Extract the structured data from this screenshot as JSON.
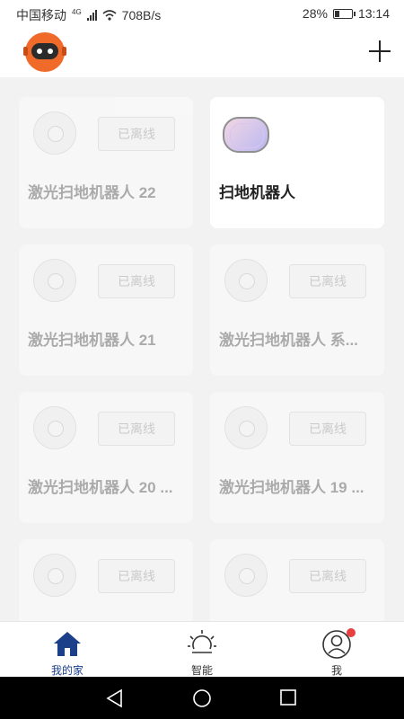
{
  "status_bar": {
    "carrier": "中国移动",
    "network": "4G",
    "speed": "708B/s",
    "battery_percent": "28%",
    "battery_level": 0.28,
    "time": "13:14"
  },
  "header": {
    "avatar_icon": "robot-mascot-icon",
    "add_icon": "plus-icon"
  },
  "devices": [
    {
      "name": "激光扫地机器人 22",
      "status": "已离线",
      "online": false
    },
    {
      "name": "扫地机器人",
      "status": "",
      "online": true
    },
    {
      "name": "激光扫地机器人 21",
      "status": "已离线",
      "online": false
    },
    {
      "name": "激光扫地机器人 系...",
      "status": "已离线",
      "online": false
    },
    {
      "name": "激光扫地机器人 20 ...",
      "status": "已离线",
      "online": false
    },
    {
      "name": "激光扫地机器人 19 ...",
      "status": "已离线",
      "online": false
    },
    {
      "name": "",
      "status": "已离线",
      "online": false
    },
    {
      "name": "",
      "status": "已离线",
      "online": false
    }
  ],
  "bottom_nav": [
    {
      "label": "我的家",
      "icon": "home-icon",
      "active": true
    },
    {
      "label": "智能",
      "icon": "sun-icon",
      "active": false
    },
    {
      "label": "我",
      "icon": "user-icon",
      "active": false,
      "badge": true
    }
  ],
  "colors": {
    "accent": "#1c3f8a",
    "badge": "#e84040",
    "avatar": "#f06a2a"
  }
}
